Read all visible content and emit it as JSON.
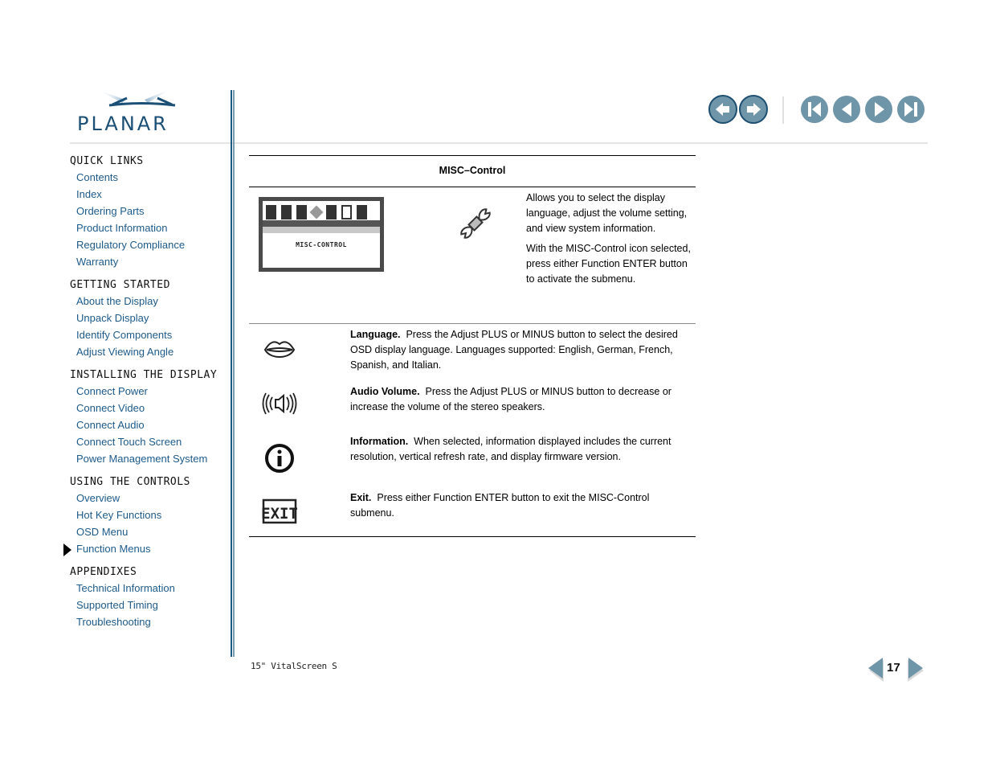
{
  "header": {
    "logo_text": "PLANAR",
    "nav_buttons": [
      {
        "name": "back",
        "icon": "arrow-left-icon"
      },
      {
        "name": "forward",
        "icon": "arrow-right-icon"
      },
      {
        "name": "first-page",
        "icon": "skip-first-icon"
      },
      {
        "name": "previous-page",
        "icon": "triangle-left-icon"
      },
      {
        "name": "next-page",
        "icon": "triangle-right-icon"
      },
      {
        "name": "last-page",
        "icon": "skip-last-icon"
      }
    ],
    "brand_color": "#1b4f75",
    "button_color": "#6f95a8"
  },
  "sidebar": {
    "sections": [
      {
        "title": "QUICK LINKS",
        "links": [
          "Contents",
          "Index",
          "Ordering Parts",
          "Product Information",
          "Regulatory Compliance",
          "Warranty"
        ]
      },
      {
        "title": "GETTING STARTED",
        "links": [
          "About the Display",
          "Unpack Display",
          "Identify Components",
          "Adjust Viewing Angle"
        ]
      },
      {
        "title": "INSTALLING THE DISPLAY",
        "links": [
          "Connect Power",
          "Connect Video",
          "Connect Audio",
          "Connect Touch Screen",
          "Power Management System"
        ]
      },
      {
        "title": "USING THE CONTROLS",
        "links": [
          "Overview",
          "Hot Key Functions",
          "OSD Menu",
          "Function Menus"
        ]
      },
      {
        "title": "APPENDIXES",
        "links": [
          "Technical Information",
          "Supported Timing",
          "Troubleshooting"
        ]
      }
    ],
    "current": "Function Menus",
    "link_color": "#1d5a8a"
  },
  "main": {
    "table_title": "MISC–Control",
    "screen_label": "MISC-CONTROL",
    "intro_paragraphs": [
      "Allows you to select the display language, adjust the volume setting, and view system information.",
      "With the MISC-Control icon selected, press either Function ENTER button to activate the submenu."
    ],
    "items": [
      {
        "icon": "lips-icon",
        "term": "Language.",
        "text": "Press the Adjust PLUS or MINUS button to select the desired OSD display language. Languages supported: English, German, French, Spanish, and Italian."
      },
      {
        "icon": "speaker-icon",
        "term": "Audio Volume.",
        "text": "Press the Adjust PLUS or MINUS button to decrease or increase the volume of the stereo speakers."
      },
      {
        "icon": "info-icon",
        "term": "Information.",
        "text": "When selected, information displayed includes the current resolution, vertical refresh rate, and display firmware version."
      },
      {
        "icon": "exit-icon",
        "term": "Exit.",
        "text": "Press either Function ENTER button to exit the MISC-Control submenu."
      }
    ]
  },
  "footer": {
    "product": "15\" VitalScreen S",
    "page_number": "17"
  }
}
